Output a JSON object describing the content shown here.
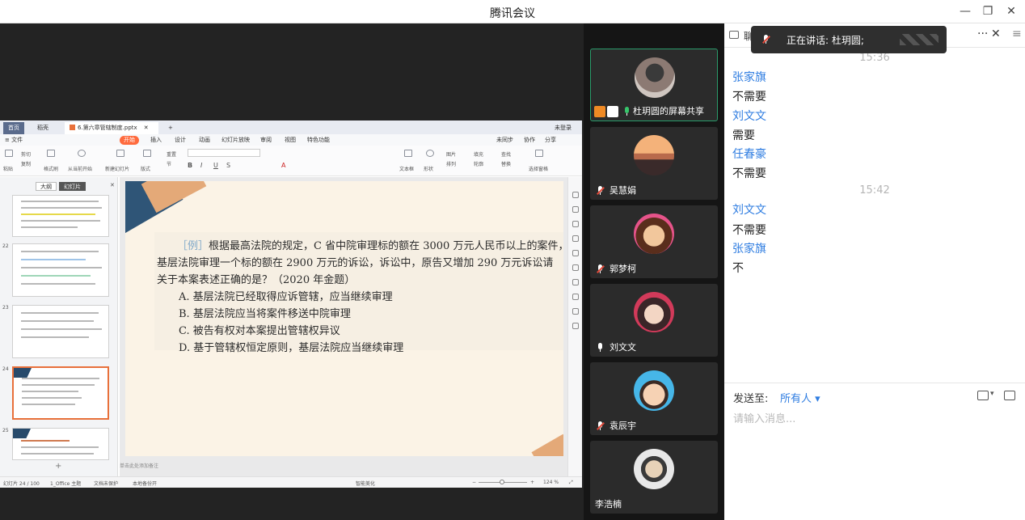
{
  "window": {
    "title": "腾讯会议",
    "minimize_icon": "minimize-icon",
    "restore_icon": "restore-icon",
    "close_icon": "close-icon"
  },
  "wps": {
    "tabs": [
      "首页",
      "稻壳",
      "6.第六章管辖制度.pptx"
    ],
    "new_tab": "+",
    "account": "未登录",
    "menu": [
      "≡ 文件",
      "开始",
      "插入",
      "设计",
      "动画",
      "幻灯片放映",
      "审阅",
      "视图",
      "特色功能"
    ],
    "menu_right": [
      "未同步",
      "协作",
      "分享"
    ],
    "ribbon": {
      "cut": "剪切",
      "copy": "复制",
      "format_painter": "格式刷",
      "paste": "粘贴",
      "play_from_current": "从当前开始",
      "new_slide": "新建幻灯片",
      "layout": "版式",
      "section": "节",
      "reset": "重置",
      "textbox": "文本框",
      "shapes": "形状",
      "picture": "图片",
      "fill": "填充",
      "find": "查找",
      "arrange": "排列",
      "outline": "轮廓",
      "replace": "替换",
      "select_pane": "选择窗格"
    },
    "thumb_tabs": [
      "大纲",
      "幻灯片"
    ],
    "thumb_numbers": [
      "22",
      "23",
      "24",
      "25"
    ],
    "slide": {
      "label": "［例］",
      "lines": [
        "根据最高法院的规定，C 省中院审理标的额在 3000 万元人民币以上的案件，",
        "基层法院审理一个标的额在 2900 万元的诉讼，诉讼中，原告又增加 290 万元诉讼请",
        "关于本案表述正确的是？（2020 年金题）"
      ],
      "options": [
        "A. 基层法院已经取得应诉管辖，应当继续审理",
        "B. 基层法院应当将案件移送中院审理",
        "C. 被告有权对本案提出管辖权异议",
        "D. 基于管辖权恒定原则，基层法院应当继续审理"
      ]
    },
    "notes_placeholder": "单击此处添加备注",
    "status": {
      "slide_count": "幻灯片 24 / 100",
      "theme": "1_Office 主题",
      "protect": "文档未保护",
      "backup": "本地备份开",
      "beautify": "智能美化",
      "zoom": "124 %"
    }
  },
  "participants": [
    {
      "name": "杜玥圆的屏幕共享",
      "mic": "on",
      "sharing": true
    },
    {
      "name": "吴慧娟",
      "mic": "muted"
    },
    {
      "name": "郭梦柯",
      "mic": "muted"
    },
    {
      "name": "刘文文",
      "mic": "on"
    },
    {
      "name": "袁辰宇",
      "mic": "muted"
    },
    {
      "name": "李浩楠",
      "mic": "none"
    }
  ],
  "chat": {
    "header_label": "聊",
    "more_icon": "more-icon",
    "close_icon": "close-icon",
    "messages": [
      {
        "type": "time",
        "text": "15:36"
      },
      {
        "type": "sender",
        "text": "张家旗"
      },
      {
        "type": "msg",
        "text": "不需要"
      },
      {
        "type": "sender",
        "text": "刘文文"
      },
      {
        "type": "msg",
        "text": "需要"
      },
      {
        "type": "sender",
        "text": "任春豪"
      },
      {
        "type": "msg",
        "text": "不需要"
      },
      {
        "type": "time",
        "text": "15:42"
      },
      {
        "type": "sender",
        "text": "刘文文"
      },
      {
        "type": "msg",
        "text": "不需要"
      },
      {
        "type": "sender",
        "text": "张家旗"
      },
      {
        "type": "msg",
        "text": "不"
      }
    ],
    "send_to_label": "发送至:",
    "send_to_target": "所有人 ▾",
    "input_placeholder": "请输入消息..."
  },
  "toast": {
    "speaking": "正在讲话: 杜玥圆;"
  },
  "colors": {
    "accent_blue": "#2f7de1",
    "active_green": "#2a9a6a",
    "wps_orange": "#ff6a3d",
    "muted_red": "#e24a3b"
  }
}
